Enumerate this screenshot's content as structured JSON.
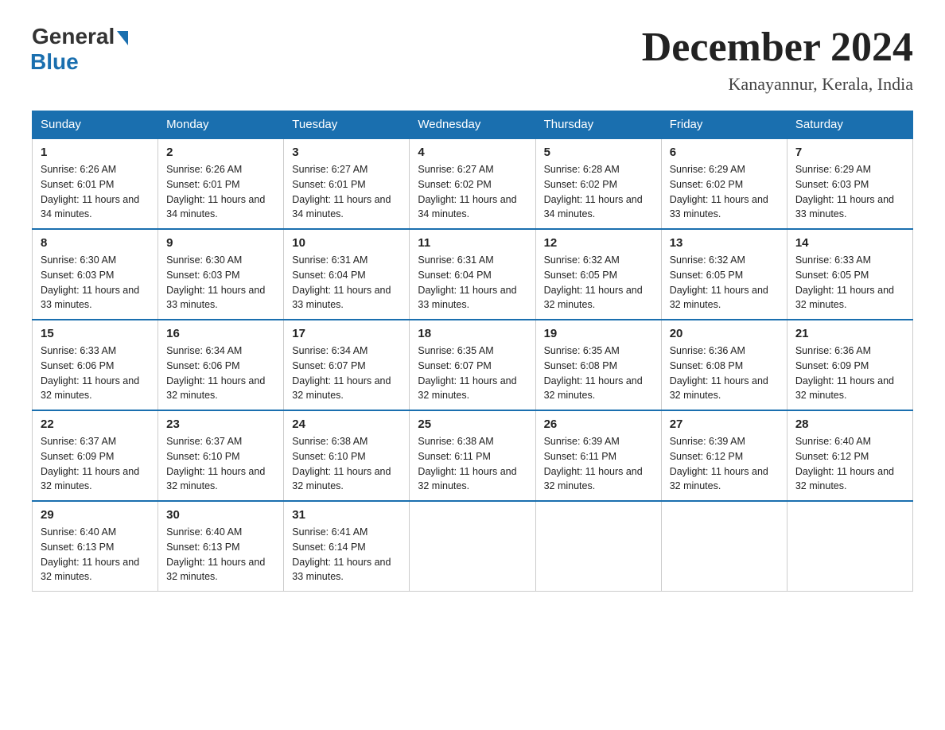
{
  "header": {
    "logo_general": "General",
    "logo_blue": "Blue",
    "month_year": "December 2024",
    "location": "Kanayannur, Kerala, India"
  },
  "days_of_week": [
    "Sunday",
    "Monday",
    "Tuesday",
    "Wednesday",
    "Thursday",
    "Friday",
    "Saturday"
  ],
  "weeks": [
    [
      {
        "day": "1",
        "sunrise": "6:26 AM",
        "sunset": "6:01 PM",
        "daylight": "11 hours and 34 minutes."
      },
      {
        "day": "2",
        "sunrise": "6:26 AM",
        "sunset": "6:01 PM",
        "daylight": "11 hours and 34 minutes."
      },
      {
        "day": "3",
        "sunrise": "6:27 AM",
        "sunset": "6:01 PM",
        "daylight": "11 hours and 34 minutes."
      },
      {
        "day": "4",
        "sunrise": "6:27 AM",
        "sunset": "6:02 PM",
        "daylight": "11 hours and 34 minutes."
      },
      {
        "day": "5",
        "sunrise": "6:28 AM",
        "sunset": "6:02 PM",
        "daylight": "11 hours and 34 minutes."
      },
      {
        "day": "6",
        "sunrise": "6:29 AM",
        "sunset": "6:02 PM",
        "daylight": "11 hours and 33 minutes."
      },
      {
        "day": "7",
        "sunrise": "6:29 AM",
        "sunset": "6:03 PM",
        "daylight": "11 hours and 33 minutes."
      }
    ],
    [
      {
        "day": "8",
        "sunrise": "6:30 AM",
        "sunset": "6:03 PM",
        "daylight": "11 hours and 33 minutes."
      },
      {
        "day": "9",
        "sunrise": "6:30 AM",
        "sunset": "6:03 PM",
        "daylight": "11 hours and 33 minutes."
      },
      {
        "day": "10",
        "sunrise": "6:31 AM",
        "sunset": "6:04 PM",
        "daylight": "11 hours and 33 minutes."
      },
      {
        "day": "11",
        "sunrise": "6:31 AM",
        "sunset": "6:04 PM",
        "daylight": "11 hours and 33 minutes."
      },
      {
        "day": "12",
        "sunrise": "6:32 AM",
        "sunset": "6:05 PM",
        "daylight": "11 hours and 32 minutes."
      },
      {
        "day": "13",
        "sunrise": "6:32 AM",
        "sunset": "6:05 PM",
        "daylight": "11 hours and 32 minutes."
      },
      {
        "day": "14",
        "sunrise": "6:33 AM",
        "sunset": "6:05 PM",
        "daylight": "11 hours and 32 minutes."
      }
    ],
    [
      {
        "day": "15",
        "sunrise": "6:33 AM",
        "sunset": "6:06 PM",
        "daylight": "11 hours and 32 minutes."
      },
      {
        "day": "16",
        "sunrise": "6:34 AM",
        "sunset": "6:06 PM",
        "daylight": "11 hours and 32 minutes."
      },
      {
        "day": "17",
        "sunrise": "6:34 AM",
        "sunset": "6:07 PM",
        "daylight": "11 hours and 32 minutes."
      },
      {
        "day": "18",
        "sunrise": "6:35 AM",
        "sunset": "6:07 PM",
        "daylight": "11 hours and 32 minutes."
      },
      {
        "day": "19",
        "sunrise": "6:35 AM",
        "sunset": "6:08 PM",
        "daylight": "11 hours and 32 minutes."
      },
      {
        "day": "20",
        "sunrise": "6:36 AM",
        "sunset": "6:08 PM",
        "daylight": "11 hours and 32 minutes."
      },
      {
        "day": "21",
        "sunrise": "6:36 AM",
        "sunset": "6:09 PM",
        "daylight": "11 hours and 32 minutes."
      }
    ],
    [
      {
        "day": "22",
        "sunrise": "6:37 AM",
        "sunset": "6:09 PM",
        "daylight": "11 hours and 32 minutes."
      },
      {
        "day": "23",
        "sunrise": "6:37 AM",
        "sunset": "6:10 PM",
        "daylight": "11 hours and 32 minutes."
      },
      {
        "day": "24",
        "sunrise": "6:38 AM",
        "sunset": "6:10 PM",
        "daylight": "11 hours and 32 minutes."
      },
      {
        "day": "25",
        "sunrise": "6:38 AM",
        "sunset": "6:11 PM",
        "daylight": "11 hours and 32 minutes."
      },
      {
        "day": "26",
        "sunrise": "6:39 AM",
        "sunset": "6:11 PM",
        "daylight": "11 hours and 32 minutes."
      },
      {
        "day": "27",
        "sunrise": "6:39 AM",
        "sunset": "6:12 PM",
        "daylight": "11 hours and 32 minutes."
      },
      {
        "day": "28",
        "sunrise": "6:40 AM",
        "sunset": "6:12 PM",
        "daylight": "11 hours and 32 minutes."
      }
    ],
    [
      {
        "day": "29",
        "sunrise": "6:40 AM",
        "sunset": "6:13 PM",
        "daylight": "11 hours and 32 minutes."
      },
      {
        "day": "30",
        "sunrise": "6:40 AM",
        "sunset": "6:13 PM",
        "daylight": "11 hours and 32 minutes."
      },
      {
        "day": "31",
        "sunrise": "6:41 AM",
        "sunset": "6:14 PM",
        "daylight": "11 hours and 33 minutes."
      },
      null,
      null,
      null,
      null
    ]
  ]
}
